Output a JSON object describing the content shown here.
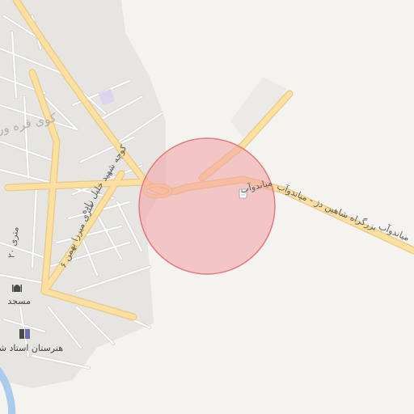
{
  "map": {
    "colors": {
      "background": "#f4f3ef",
      "urban": "#e6e5e1",
      "major_road": "#fbe0a2",
      "major_road_casing": "#e9c983",
      "minor_road": "#ffffff",
      "minor_road_casing": "#d9d7d2",
      "water": "#a8cce9",
      "highlight_circle_fill": "#f3a0a4",
      "highlight_circle_stroke": "#e27a80"
    },
    "labels": {
      "district": "کوی قره ور",
      "highway_a": "بزرگراه شاهین دژ - میاندوآب",
      "highway_b": "میاندوآب",
      "street_shahid": "کوچه شهید خلیل زاده",
      "street_mirza": "۶ متری میرزا بهمن",
      "street_twenty": "۲۰ متری"
    },
    "pois": [
      {
        "name": "مسجد",
        "icon": "mosque-icon"
      },
      {
        "name": "هنرستان استاد شه",
        "icon": "school-icon"
      }
    ]
  }
}
